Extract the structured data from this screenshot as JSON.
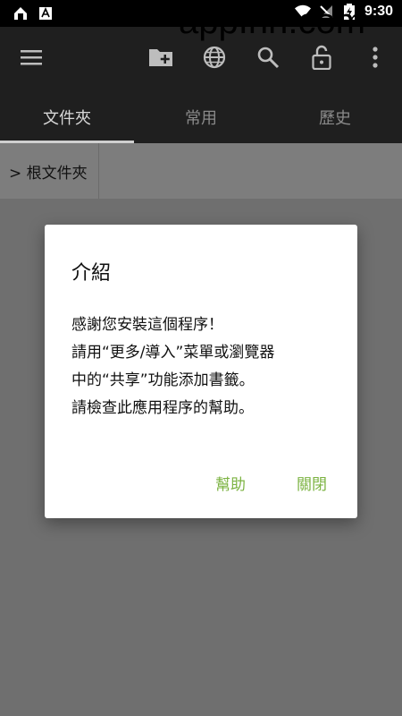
{
  "status_bar": {
    "time": "9:30",
    "icons": [
      "notification-icon",
      "app-icon",
      "wifi-icon",
      "no-signal-icon",
      "battery-charging-icon"
    ]
  },
  "watermark": "appInn.com",
  "toolbar": {
    "icons": [
      "menu-icon",
      "new-folder-icon",
      "globe-icon",
      "search-icon",
      "unlock-icon",
      "more-vert-icon"
    ]
  },
  "tabs": [
    {
      "label": "文件夾",
      "active": true
    },
    {
      "label": "常用",
      "active": false
    },
    {
      "label": "歷史",
      "active": false
    }
  ],
  "breadcrumb": {
    "label": "> 根文件夾"
  },
  "dialog": {
    "title": "介紹",
    "lines": [
      "感謝您安裝這個程序！",
      "請用“更多/導入”菜單或瀏覽器",
      "中的“共享”功能添加書籤。",
      "請檢查此應用程序的幫助。"
    ],
    "help_label": "幫助",
    "close_label": "關閉"
  },
  "colors": {
    "accent": "#7cb342",
    "toolbar": "#1f1f1f",
    "scrim_bg": "#6f6f6f"
  }
}
